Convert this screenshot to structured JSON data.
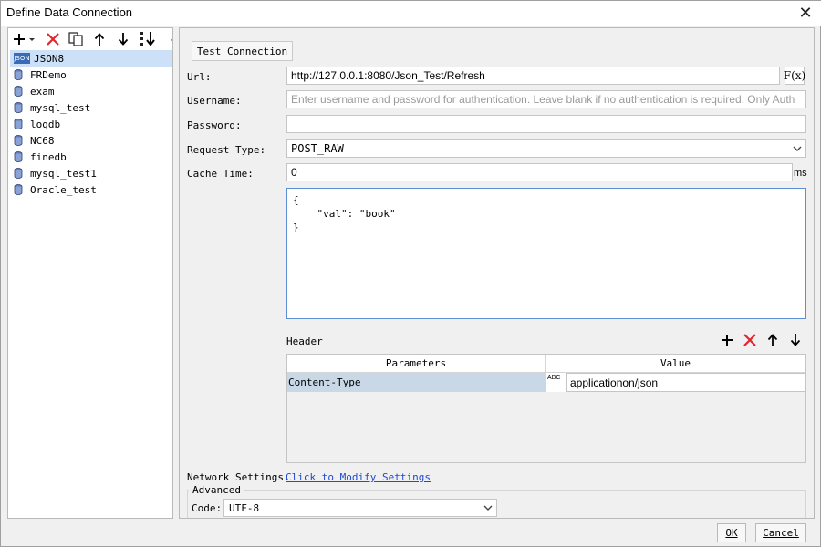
{
  "window": {
    "title": "Define Data Connection",
    "close_glyph": "✕"
  },
  "left_toolbar": {
    "icons": [
      "add-icon",
      "delete-icon",
      "copy-icon",
      "move-up-icon",
      "move-down-icon",
      "sort-icon"
    ]
  },
  "connections": [
    {
      "label": "JSON8",
      "icon": "json-icon",
      "selected": true
    },
    {
      "label": "FRDemo",
      "icon": "database-icon"
    },
    {
      "label": "exam",
      "icon": "database-icon"
    },
    {
      "label": "mysql_test",
      "icon": "database-icon"
    },
    {
      "label": "logdb",
      "icon": "database-icon"
    },
    {
      "label": "NC68",
      "icon": "database-icon"
    },
    {
      "label": "finedb",
      "icon": "database-icon"
    },
    {
      "label": "mysql_test1",
      "icon": "database-icon"
    },
    {
      "label": "Oracle_test",
      "icon": "database-icon"
    }
  ],
  "json_badge": "JSON",
  "form": {
    "test_button": "Test Connection",
    "url_label": "Url:",
    "url_value": "http://127.0.0.1:8080/Json_Test/Refresh",
    "fx_label": "F(x)",
    "username_label": "Username:",
    "username_placeholder": "Enter username and password for authentication. Leave blank if no authentication is required. Only Auth",
    "password_label": "Password:",
    "password_value": "",
    "request_type_label": "Request Type:",
    "request_type_value": "POST_RAW",
    "cache_time_label": "Cache Time:",
    "cache_time_value": "0",
    "cache_time_unit": "ms",
    "body": "{\n    \"val\": \"book\"\n}"
  },
  "header": {
    "label": "Header",
    "columns": [
      "Parameters",
      "Value"
    ],
    "rows": [
      {
        "parameter": "Content-Type",
        "type_icon": "ABC",
        "value": "applicationon/json"
      }
    ],
    "toolbar_icons": [
      "add-icon",
      "delete-icon",
      "move-up-icon",
      "move-down-icon"
    ]
  },
  "network": {
    "label": "Network Settings:",
    "link": "Click to Modify Settings"
  },
  "advanced": {
    "group_label": "Advanced",
    "code_label": "Code:",
    "code_value": "UTF-8"
  },
  "footer": {
    "ok": "OK",
    "cancel": "Cancel"
  },
  "colors": {
    "accent_selection": "#cce0f7",
    "row_selection": "#c8d8e6",
    "delete_red": "#e0252b",
    "link_blue": "#1d4ad6",
    "focus_border": "#5b8fd6"
  }
}
